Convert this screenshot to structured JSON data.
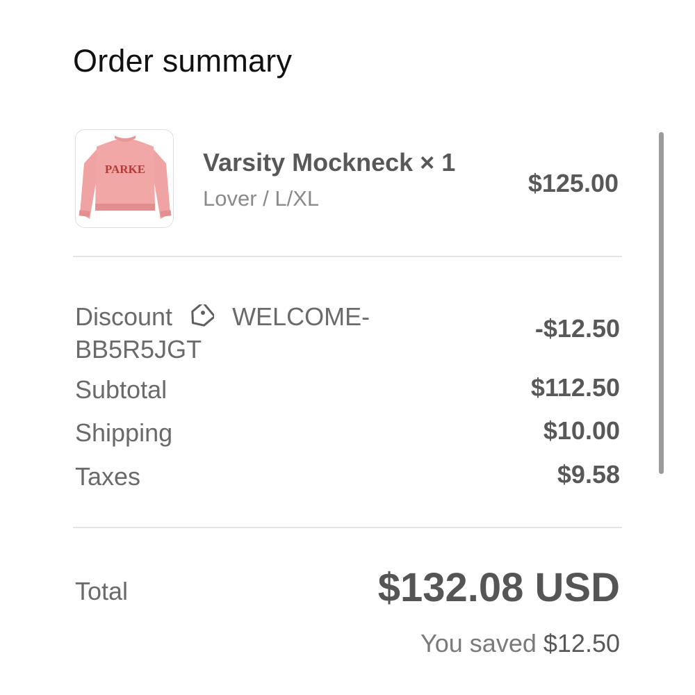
{
  "header": {
    "title": "Order summary"
  },
  "item": {
    "thumbnail_icon": "sweatshirt-thumbnail",
    "thumbnail_text": "PARKE",
    "name": "Varsity Mockneck × 1",
    "variant": "Lover / L/XL",
    "price": "$125.00"
  },
  "summary": {
    "discount_label": "Discount",
    "discount_icon": "tag-icon",
    "discount_code": "WELCOME-BB5R5JGT",
    "discount_value": "-$12.50",
    "subtotal_label": "Subtotal",
    "subtotal_value": "$112.50",
    "shipping_label": "Shipping",
    "shipping_value": "$10.00",
    "taxes_label": "Taxes",
    "taxes_value": "$9.58"
  },
  "total": {
    "label": "Total",
    "value": "$132.08 USD",
    "saved_prefix": "You saved",
    "saved_amount": "$12.50"
  },
  "colors": {
    "sweatshirt": "#f0a3a3",
    "lettering": "#b53a3a"
  }
}
